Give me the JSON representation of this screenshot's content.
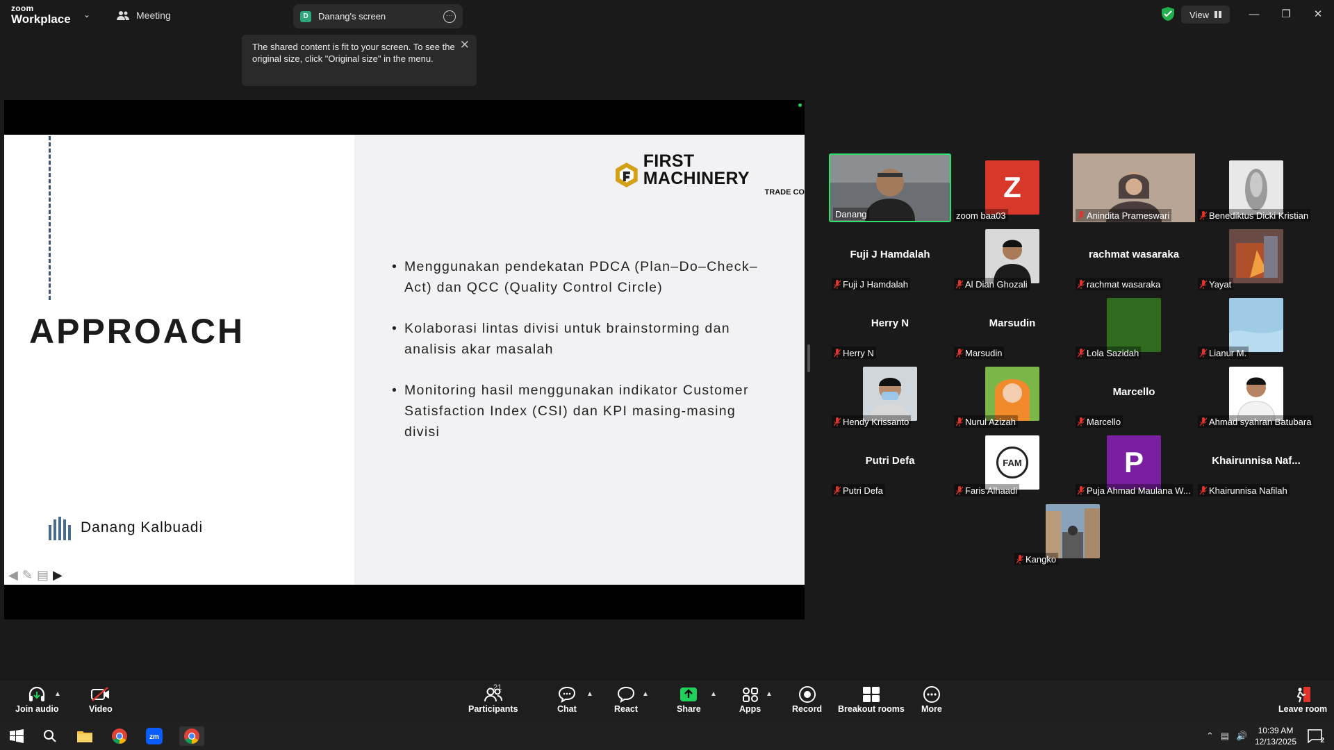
{
  "app": {
    "logo_line1": "zoom",
    "logo_line2": "Workplace"
  },
  "tabs": {
    "meeting": "Meeting",
    "share": "Danang's screen",
    "share_badge": "D"
  },
  "header": {
    "view_label": "View"
  },
  "notice": {
    "text": "The shared content is fit to your screen. To see the original size, click \"Original size\" in the menu."
  },
  "slide": {
    "title": "APPROACH",
    "presenter": "Danang Kalbuadi",
    "company_name": "FIRST MACHINERY",
    "company_sub": "TRADE CO",
    "bullets": [
      "Menggunakan pendekatan PDCA (Plan–Do–Check–Act) dan QCC (Quality Control Circle)",
      "Kolaborasi lintas divisi untuk brainstorming dan analisis akar masalah",
      "Monitoring hasil menggunakan indikator Customer Satisfaction Index (CSI) dan KPI masing-masing divisi"
    ]
  },
  "participants": [
    {
      "label": "Danang",
      "big": "",
      "muted": false
    },
    {
      "label": "zoom baa03",
      "big": "",
      "letter": "Z",
      "muted": false
    },
    {
      "label": "Anindita Prameswari",
      "big": "",
      "muted": true
    },
    {
      "label": "Benediktus Dicki Kristian",
      "big": "",
      "muted": true
    },
    {
      "label": "Fuji J Hamdalah",
      "big": "Fuji J Hamdalah",
      "muted": true
    },
    {
      "label": "Al Dian Ghozali",
      "big": "",
      "muted": true
    },
    {
      "label": "rachmat wasaraka",
      "big": "rachmat wasaraka",
      "muted": true
    },
    {
      "label": "Yayat",
      "big": "",
      "muted": true
    },
    {
      "label": "Herry N",
      "big": "Herry N",
      "muted": true
    },
    {
      "label": "Marsudin",
      "big": "Marsudin",
      "muted": true
    },
    {
      "label": "Lola Sazidah",
      "big": "",
      "muted": true
    },
    {
      "label": "Lianur M.",
      "big": "",
      "muted": true
    },
    {
      "label": "Hendy Krissanto",
      "big": "",
      "muted": true
    },
    {
      "label": "Nurul Azizah",
      "big": "",
      "muted": true
    },
    {
      "label": "Marcello",
      "big": "Marcello",
      "muted": true
    },
    {
      "label": "Ahmad syahran Batubara",
      "big": "",
      "muted": true
    },
    {
      "label": "Putri Defa",
      "big": "Putri Defa",
      "muted": true
    },
    {
      "label": "Faris Alhaadi",
      "big": "",
      "letter": "FAM",
      "muted": true
    },
    {
      "label": "Puja Ahmad Maulana W...",
      "big": "",
      "letter": "P",
      "muted": true
    },
    {
      "label": "Khairunnisa Nafilah",
      "big": "Khairunnisa  Naf...",
      "muted": true
    },
    {
      "label": "Kangko",
      "big": "",
      "muted": true
    }
  ],
  "toolbar": {
    "join_audio": "Join audio",
    "video": "Video",
    "participants": "Participants",
    "participants_count": "21",
    "chat": "Chat",
    "react": "React",
    "share": "Share",
    "apps": "Apps",
    "record": "Record",
    "breakout": "Breakout rooms",
    "more": "More",
    "leave": "Leave room"
  },
  "taskbar": {
    "time": "10:39 AM",
    "date": "12/13/2025",
    "notif_count": "2"
  },
  "colors": {
    "accent_green": "#2de06b",
    "share_green": "#1fd15b",
    "muted_red": "#e2342b"
  }
}
